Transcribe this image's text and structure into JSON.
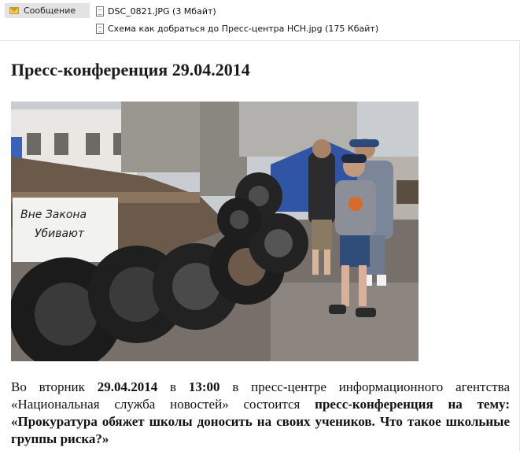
{
  "attachments_bar": {
    "message_tab": "Сообщение",
    "files": [
      "DSC_0821.JPG (3 Мбайт)",
      "Схема как добраться до Пресс-центра НСН.jpg (175 Кбайт)"
    ]
  },
  "email": {
    "title": "Пресс-конференция 29.04.2014",
    "photo_sign_text": "Вне Закона Убивают",
    "body": {
      "p1": "Во вторник ",
      "date": "29.04.2014",
      "p2": " в ",
      "time": "13:00",
      "p3": " в пресс-центре информационного агентства «Национальная служба новостей» состоится ",
      "conf": "пресс-конференция на тему: «Прокуратура обяжет школы доносить на своих учеников. Что такое школьные группы риска?»"
    }
  }
}
